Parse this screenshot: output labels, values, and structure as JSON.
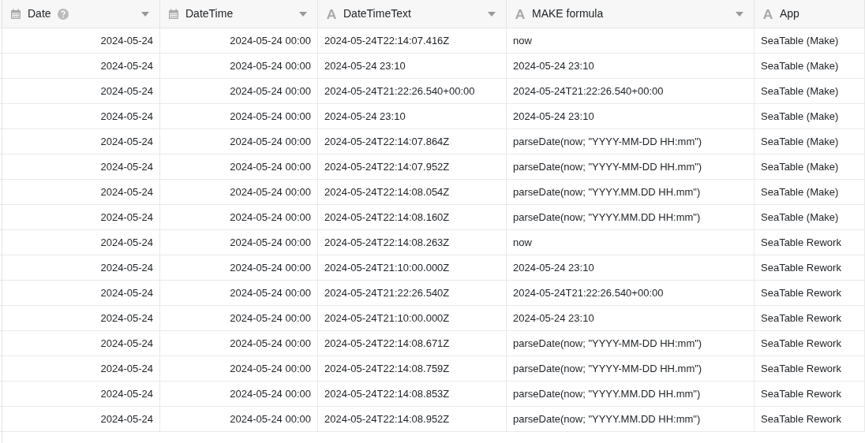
{
  "table": {
    "columns": [
      {
        "label": "Date",
        "kind": "date",
        "help": true,
        "menu": true
      },
      {
        "label": "DateTime",
        "kind": "date",
        "help": false,
        "menu": true
      },
      {
        "label": "DateTimeText",
        "kind": "text",
        "help": false,
        "menu": true
      },
      {
        "label": "MAKE formula",
        "kind": "text",
        "help": false,
        "menu": true
      },
      {
        "label": "App",
        "kind": "text",
        "help": false,
        "menu": false
      }
    ],
    "rows": [
      [
        "2024-05-24",
        "2024-05-24 00:00",
        "2024-05-24T22:14:07.416Z",
        "now",
        "SeaTable (Make)"
      ],
      [
        "2024-05-24",
        "2024-05-24 00:00",
        "2024-05-24 23:10",
        "2024-05-24 23:10",
        "SeaTable (Make)"
      ],
      [
        "2024-05-24",
        "2024-05-24 00:00",
        "2024-05-24T21:22:26.540+00:00",
        "2024-05-24T21:22:26.540+00:00",
        "SeaTable (Make)"
      ],
      [
        "2024-05-24",
        "2024-05-24 00:00",
        "2024-05-24 23:10",
        "2024-05-24 23:10",
        "SeaTable (Make)"
      ],
      [
        "2024-05-24",
        "2024-05-24 00:00",
        "2024-05-24T22:14:07.864Z",
        "parseDate(now; \"YYYY-MM-DD HH:mm\")",
        "SeaTable (Make)"
      ],
      [
        "2024-05-24",
        "2024-05-24 00:00",
        "2024-05-24T22:14:07.952Z",
        "parseDate(now; \"YYYY-MM-DD HH.mm\")",
        "SeaTable (Make)"
      ],
      [
        "2024-05-24",
        "2024-05-24 00:00",
        "2024-05-24T22:14:08.054Z",
        "parseDate(now; \"YYYY.MM.DD HH.mm\")",
        "SeaTable (Make)"
      ],
      [
        "2024-05-24",
        "2024-05-24 00:00",
        "2024-05-24T22:14:08.160Z",
        "parseDate(now; \"YYYY.MM.DD HH:mm\")",
        "SeaTable (Make)"
      ],
      [
        "2024-05-24",
        "2024-05-24 00:00",
        "2024-05-24T22:14:08.263Z",
        "now",
        "SeaTable Rework"
      ],
      [
        "2024-05-24",
        "2024-05-24 00:00",
        "2024-05-24T21:10:00.000Z",
        "2024-05-24 23:10",
        "SeaTable Rework"
      ],
      [
        "2024-05-24",
        "2024-05-24 00:00",
        "2024-05-24T21:22:26.540Z",
        "2024-05-24T21:22:26.540+00:00",
        "SeaTable Rework"
      ],
      [
        "2024-05-24",
        "2024-05-24 00:00",
        "2024-05-24T21:10:00.000Z",
        "2024-05-24 23:10",
        "SeaTable Rework"
      ],
      [
        "2024-05-24",
        "2024-05-24 00:00",
        "2024-05-24T22:14:08.671Z",
        "parseDate(now; \"YYYY-MM-DD HH:mm\")",
        "SeaTable Rework"
      ],
      [
        "2024-05-24",
        "2024-05-24 00:00",
        "2024-05-24T22:14:08.759Z",
        "parseDate(now; \"YYYY-MM-DD HH.mm\")",
        "SeaTable Rework"
      ],
      [
        "2024-05-24",
        "2024-05-24 00:00",
        "2024-05-24T22:14:08.853Z",
        "parseDate(now; \"YYYY.MM.DD HH.mm\")",
        "SeaTable Rework"
      ],
      [
        "2024-05-24",
        "2024-05-24 00:00",
        "2024-05-24T22:14:08.952Z",
        "parseDate(now; \"YYYY.MM.DD HH:mm\")",
        "SeaTable Rework"
      ]
    ]
  }
}
